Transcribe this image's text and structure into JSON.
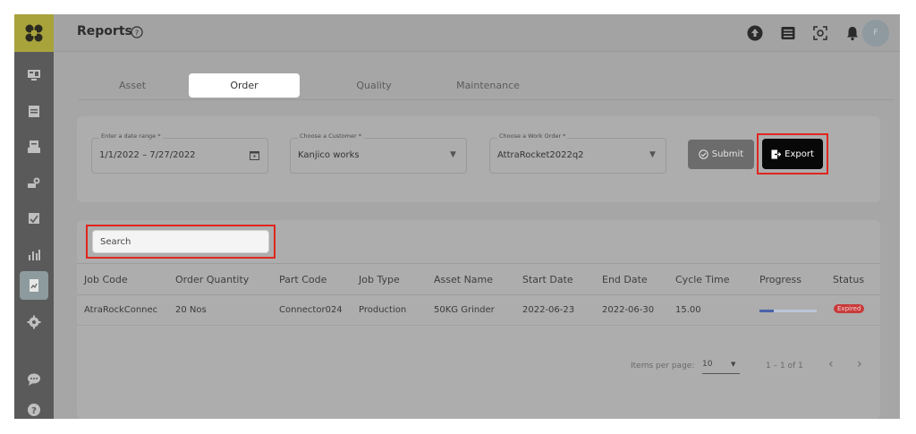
{
  "header": {
    "title": "Reports",
    "avatar_initial": "F"
  },
  "tabs": [
    {
      "label": "Asset"
    },
    {
      "label": "Order"
    },
    {
      "label": "Quality"
    },
    {
      "label": "Maintenance"
    }
  ],
  "filters": {
    "date_range": {
      "label": "Enter a date range *",
      "value": "1/1/2022 – 7/27/2022"
    },
    "customer": {
      "label": "Choose a Customer *",
      "value": "Kanjico works"
    },
    "work_order": {
      "label": "Choose a Work Order *",
      "value": "AttraRocket2022q2"
    },
    "submit_label": "Submit",
    "export_label": "Export"
  },
  "search": {
    "placeholder": "Search"
  },
  "table": {
    "columns": [
      "Job Code",
      "Order Quantity",
      "Part Code",
      "Job Type",
      "Asset Name",
      "Start Date",
      "End Date",
      "Cycle Time",
      "Progress",
      "Status"
    ],
    "rows": [
      {
        "job_code": "AtraRockConnec",
        "order_quantity": "20 Nos",
        "part_code": "Connector024",
        "job_type": "Production",
        "asset_name": "50KG Grinder",
        "start_date": "2022-06-23",
        "end_date": "2022-06-30",
        "cycle_time": "15.00",
        "progress": 0.25,
        "status": "Expired"
      }
    ]
  },
  "pagination": {
    "items_per_page_label": "Items per page:",
    "items_per_page": "10",
    "range": "1 – 1 of 1"
  },
  "colors": {
    "accent_red": "#e0261e",
    "logo_bg": "#a8a33b",
    "status_expired": "#c93a3a"
  }
}
